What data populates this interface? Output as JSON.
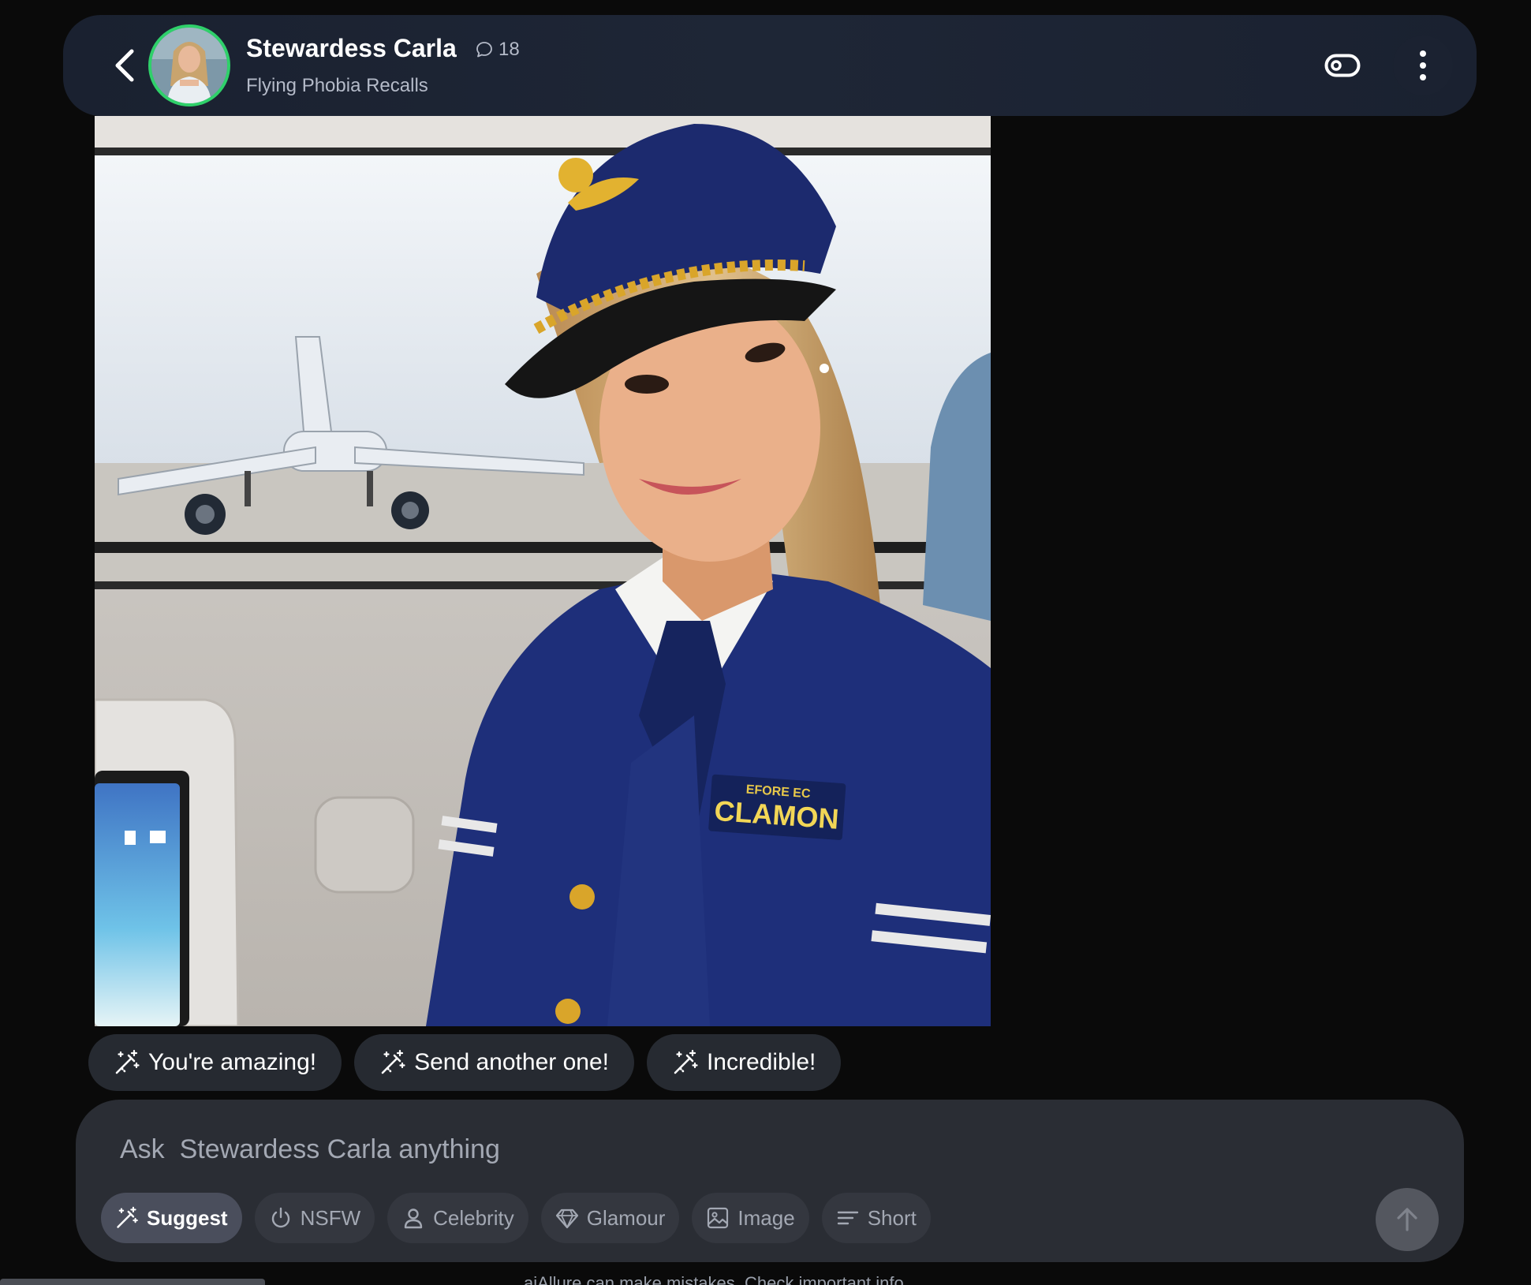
{
  "header": {
    "back_icon": "chevron-left-icon",
    "avatar_alt": "Stewardess Carla avatar",
    "title": "Stewardess Carla",
    "message_count": "18",
    "subtitle": "Flying Phobia Recalls",
    "toggle_icon": "toggle-icon",
    "more_icon": "more-vertical-icon"
  },
  "message": {
    "image_alt": "Stewardess Carla in navy flight attendant uniform inside an airplane",
    "badge_text": "CLAMON",
    "badge_small_text": "EFORE EC"
  },
  "suggestions": [
    {
      "label": "You're amazing!",
      "icon": "magic-wand-icon"
    },
    {
      "label": "Send another one!",
      "icon": "magic-wand-icon"
    },
    {
      "label": "Incredible!",
      "icon": "magic-wand-icon"
    }
  ],
  "composer": {
    "placeholder": "Ask  Stewardess Carla anything",
    "value": "",
    "tools": [
      {
        "label": "Suggest",
        "icon": "magic-wand-icon",
        "active": true
      },
      {
        "label": "NSFW",
        "icon": "power-icon",
        "active": false
      },
      {
        "label": "Celebrity",
        "icon": "user-icon",
        "active": false
      },
      {
        "label": "Glamour",
        "icon": "diamond-icon",
        "active": false
      },
      {
        "label": "Image",
        "icon": "image-icon",
        "active": false
      },
      {
        "label": "Short",
        "icon": "text-lines-icon",
        "active": false
      }
    ],
    "send_icon": "arrow-up-icon"
  },
  "footer": {
    "disclaimer": "aiAllure can make mistakes. Check important info."
  },
  "colors": {
    "background": "#0a0a0a",
    "header_bg": "#1e2636",
    "avatar_ring": "#2fd06a",
    "chip_bg": "#262a31",
    "composer_bg": "#2a2d34",
    "tool_bg": "#34373f",
    "tool_active_bg": "#4a4e5c",
    "send_bg": "#54575f"
  }
}
